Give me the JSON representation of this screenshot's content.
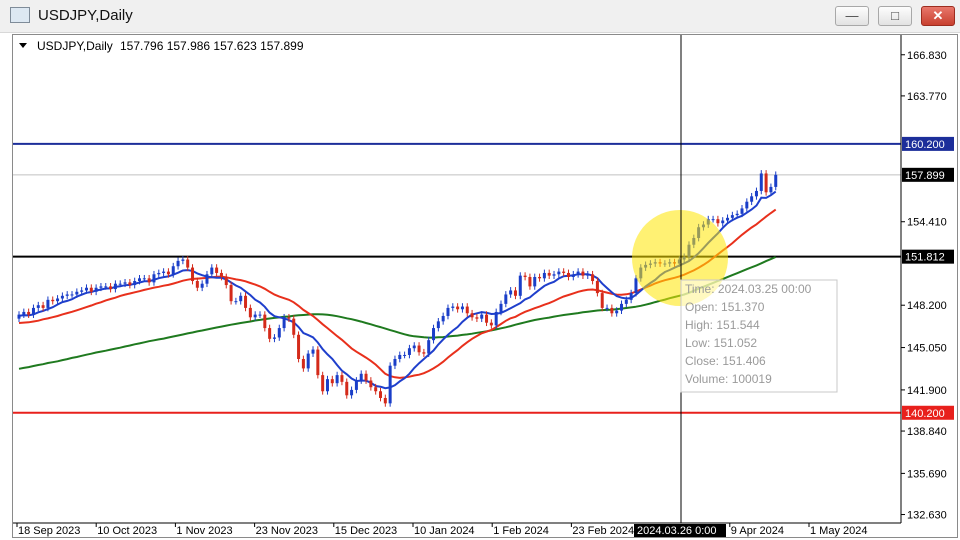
{
  "window": {
    "title": "USDJPY,Daily",
    "minimize_glyph": "—",
    "maximize_glyph": "□",
    "close_glyph": "✕"
  },
  "chart_header": {
    "symbol_timeframe": "USDJPY,Daily",
    "ohlc": "157.796 157.986 157.623 157.899"
  },
  "colors": {
    "sma_fast": "#1f3fcc",
    "sma_mid": "#e8301c",
    "sma_slow": "#1f7a1f",
    "bull": "#1a3ec8",
    "bear": "#d42a1a",
    "level_160": "#1c2e9a",
    "level_140": "#e8201c",
    "price_tag_dark": "#000000",
    "highlight": "#ffe600"
  },
  "chart_data": {
    "type": "candlestick",
    "y_ticks": [
      "166.830",
      "163.770",
      "154.410",
      "148.200",
      "145.050",
      "141.900",
      "138.840",
      "135.690",
      "132.630"
    ],
    "x_labels": [
      "18 Sep 2023",
      "10 Oct 2023",
      "1 Nov 2023",
      "23 Nov 2023",
      "15 Dec 2023",
      "10 Jan 2024",
      "1 Feb 2024",
      "23 Feb 2024",
      "2024.03.26 0:00",
      "9 Apr 2024",
      "1 May 2024"
    ],
    "ylim": [
      132.0,
      168.3
    ],
    "levels": [
      {
        "label": "160.200",
        "value": 160.2,
        "color": "level_160"
      },
      {
        "label": "151.812",
        "value": 151.812,
        "color": "price_tag_dark"
      },
      {
        "label": "140.200",
        "value": 140.2,
        "color": "level_140"
      }
    ],
    "current_price": "157.899",
    "crosshair_date": "2024.03.26 0:00",
    "candle_tooltip": {
      "time": "Time: 2024.03.25 00:00",
      "open": "Open: 151.370",
      "high": "High: 151.544",
      "low": "Low:  151.052",
      "close": "Close: 151.406",
      "volume": "Volume: 100019"
    },
    "series": [
      {
        "name": "close",
        "values": [
          147.5,
          147.7,
          147.5,
          148.0,
          148.2,
          148.0,
          148.6,
          148.5,
          148.7,
          148.9,
          149.0,
          149.0,
          149.2,
          149.3,
          149.5,
          149.2,
          149.5,
          149.6,
          149.6,
          149.4,
          149.8,
          149.8,
          149.9,
          149.7,
          150.0,
          150.2,
          150.2,
          149.9,
          150.5,
          150.6,
          150.7,
          150.5,
          151.1,
          151.5,
          151.6,
          151.0,
          150.0,
          149.5,
          149.8,
          150.5,
          151.0,
          150.6,
          150.3,
          149.7,
          148.5,
          148.5,
          148.9,
          148.0,
          147.3,
          147.5,
          147.5,
          146.5,
          145.7,
          145.8,
          146.5,
          147.3,
          147.2,
          146.0,
          144.2,
          143.5,
          144.6,
          144.9,
          143.0,
          141.8,
          142.7,
          142.4,
          143.0,
          142.5,
          141.5,
          141.9,
          142.6,
          143.1,
          142.6,
          142.1,
          141.8,
          141.3,
          140.9,
          143.7,
          144.2,
          144.5,
          144.5,
          145.0,
          145.2,
          144.7,
          144.6,
          145.6,
          146.5,
          147.0,
          147.4,
          148.0,
          148.1,
          147.9,
          148.1,
          147.6,
          147.3,
          147.2,
          147.5,
          146.9,
          146.7,
          147.7,
          148.3,
          149.0,
          149.3,
          148.9,
          150.4,
          150.3,
          149.6,
          150.3,
          150.2,
          150.6,
          150.4,
          150.5,
          150.7,
          150.6,
          150.3,
          150.5,
          150.7,
          150.4,
          150.5,
          150.0,
          149.1,
          148.0,
          148.0,
          147.6,
          147.8,
          148.3,
          148.6,
          149.1,
          150.2,
          151.0,
          151.2,
          151.3,
          151.4,
          151.3,
          151.3,
          151.4,
          151.3,
          151.6,
          151.8,
          152.7,
          153.2,
          154.0,
          154.2,
          154.6,
          154.6,
          154.3,
          154.5,
          154.7,
          154.9,
          155.0,
          155.4,
          155.9,
          156.3,
          156.7,
          158.0,
          156.6,
          157.0,
          157.9
        ]
      },
      {
        "name": "ma_fast",
        "values": [
          147.42,
          147.46,
          147.44,
          147.52,
          147.67,
          147.78,
          147.91,
          148.05,
          148.25,
          148.43,
          148.52,
          148.65,
          148.84,
          148.98,
          149.12,
          149.18,
          149.29,
          149.37,
          149.44,
          149.45,
          149.56,
          149.61,
          149.69,
          149.71,
          149.79,
          149.89,
          149.98,
          149.99,
          150.09,
          150.21,
          150.29,
          150.34,
          150.47,
          150.62,
          150.78,
          150.81,
          150.75,
          150.57,
          150.43,
          150.33,
          150.28,
          150.24,
          150.24,
          150.12,
          149.89,
          149.67,
          149.5,
          149.23,
          148.95,
          148.61,
          148.4,
          148.08,
          147.65,
          147.38,
          147.3,
          147.23,
          147.1,
          146.93,
          146.58,
          146.13,
          145.98,
          145.81,
          145.43,
          144.93,
          144.54,
          144.21,
          143.75,
          143.33,
          143.06,
          142.75,
          142.56,
          142.59,
          142.59,
          142.43,
          142.19,
          142.14,
          142.03,
          142.09,
          142.25,
          142.54,
          142.77,
          143.1,
          143.53,
          143.89,
          144.2,
          144.51,
          144.83,
          145.28,
          145.66,
          146.0,
          146.31,
          146.58,
          146.97,
          147.27,
          147.51,
          147.6,
          147.69,
          147.64,
          147.55,
          147.57,
          147.63,
          147.79,
          147.98,
          148.17,
          148.35,
          148.63,
          148.78,
          149.08,
          149.36,
          149.64,
          149.81,
          149.94,
          150.19,
          150.36,
          150.39,
          150.42,
          150.51,
          150.51,
          150.51,
          150.41,
          150.21,
          149.81,
          149.48,
          149.15,
          148.88,
          148.76,
          148.7,
          148.73,
          148.98,
          149.29,
          149.6,
          149.85,
          150.08,
          150.42,
          150.67,
          150.82,
          150.99,
          151.15,
          151.31,
          151.49,
          151.76,
          152.07,
          152.44,
          152.84,
          153.2,
          153.55,
          153.95,
          154.29,
          154.53,
          154.71,
          154.85,
          155.08,
          155.32,
          155.62,
          156.2,
          156.18,
          156.38,
          156.65
        ]
      },
      {
        "name": "ma_mid",
        "values": [
          146.88,
          146.91,
          146.93,
          146.99,
          147.05,
          147.15,
          147.22,
          147.31,
          147.4,
          147.52,
          147.61,
          147.71,
          147.82,
          147.94,
          148.06,
          148.18,
          148.31,
          148.42,
          148.56,
          148.66,
          148.76,
          148.89,
          148.99,
          149.07,
          149.16,
          149.24,
          149.34,
          149.42,
          149.51,
          149.57,
          149.65,
          149.71,
          149.81,
          149.91,
          150.02,
          150.1,
          150.16,
          150.18,
          150.2,
          150.23,
          150.28,
          150.32,
          150.33,
          150.28,
          150.2,
          150.12,
          150.07,
          149.98,
          149.85,
          149.73,
          149.6,
          149.42,
          149.2,
          148.99,
          148.84,
          148.72,
          148.6,
          148.42,
          148.15,
          147.85,
          147.62,
          147.4,
          147.1,
          146.78,
          146.5,
          146.2,
          145.9,
          145.63,
          145.31,
          144.99,
          144.74,
          144.53,
          144.3,
          144.06,
          143.78,
          143.44,
          143.1,
          142.93,
          142.84,
          142.79,
          142.83,
          142.88,
          142.97,
          143.03,
          143.14,
          143.31,
          143.5,
          143.73,
          144.0,
          144.31,
          144.59,
          144.86,
          145.17,
          145.45,
          145.7,
          145.91,
          146.11,
          146.23,
          146.36,
          146.57,
          146.8,
          147.04,
          147.23,
          147.34,
          147.54,
          147.71,
          147.84,
          147.98,
          148.1,
          148.24,
          148.36,
          148.51,
          148.69,
          148.85,
          148.96,
          149.08,
          149.2,
          149.29,
          149.35,
          149.37,
          149.32,
          149.22,
          149.14,
          149.05,
          148.99,
          148.98,
          149.01,
          149.08,
          149.21,
          149.37,
          149.52,
          149.66,
          149.82,
          149.95,
          150.06,
          150.15,
          150.24,
          150.34,
          150.47,
          150.63,
          150.79,
          150.99,
          151.2,
          151.44,
          151.71,
          151.99,
          152.26,
          152.53,
          152.82,
          153.13,
          153.44,
          153.71,
          153.98,
          154.22,
          154.51,
          154.79,
          155.06,
          155.31
        ]
      },
      {
        "name": "ma_slow",
        "values": [
          143.47,
          143.54,
          143.6,
          143.68,
          143.75,
          143.81,
          143.9,
          143.96,
          144.03,
          144.12,
          144.19,
          144.28,
          144.35,
          144.44,
          144.52,
          144.59,
          144.68,
          144.75,
          144.82,
          144.9,
          144.97,
          145.04,
          145.13,
          145.2,
          145.29,
          145.36,
          145.44,
          145.52,
          145.59,
          145.66,
          145.72,
          145.8,
          145.87,
          145.95,
          146.02,
          146.1,
          146.17,
          146.25,
          146.32,
          146.39,
          146.47,
          146.54,
          146.61,
          146.68,
          146.75,
          146.81,
          146.88,
          146.93,
          146.99,
          147.06,
          147.11,
          147.17,
          147.21,
          147.26,
          147.29,
          147.34,
          147.36,
          147.41,
          147.45,
          147.47,
          147.5,
          147.53,
          147.53,
          147.52,
          147.49,
          147.44,
          147.38,
          147.31,
          147.23,
          147.16,
          147.07,
          146.98,
          146.88,
          146.78,
          146.67,
          146.57,
          146.46,
          146.35,
          146.25,
          146.14,
          146.04,
          145.95,
          145.89,
          145.85,
          145.81,
          145.79,
          145.79,
          145.81,
          145.83,
          145.87,
          145.91,
          145.94,
          145.99,
          146.03,
          146.08,
          146.15,
          146.2,
          146.26,
          146.33,
          146.4,
          146.48,
          146.56,
          146.65,
          146.75,
          146.84,
          146.93,
          147.02,
          147.1,
          147.17,
          147.23,
          147.28,
          147.35,
          147.41,
          147.47,
          147.52,
          147.57,
          147.61,
          147.67,
          147.72,
          147.76,
          147.81,
          147.84,
          147.85,
          147.87,
          147.91,
          147.95,
          147.99,
          148.04,
          148.09,
          148.16,
          148.24,
          148.33,
          148.43,
          148.53,
          148.62,
          148.72,
          148.81,
          148.9,
          149.0,
          149.12,
          149.27,
          149.43,
          149.57,
          149.72,
          149.86,
          150.0,
          150.14,
          150.29,
          150.44,
          150.58,
          150.73,
          150.88,
          151.02,
          151.16,
          151.32,
          151.48,
          151.63,
          151.79
        ]
      }
    ]
  }
}
